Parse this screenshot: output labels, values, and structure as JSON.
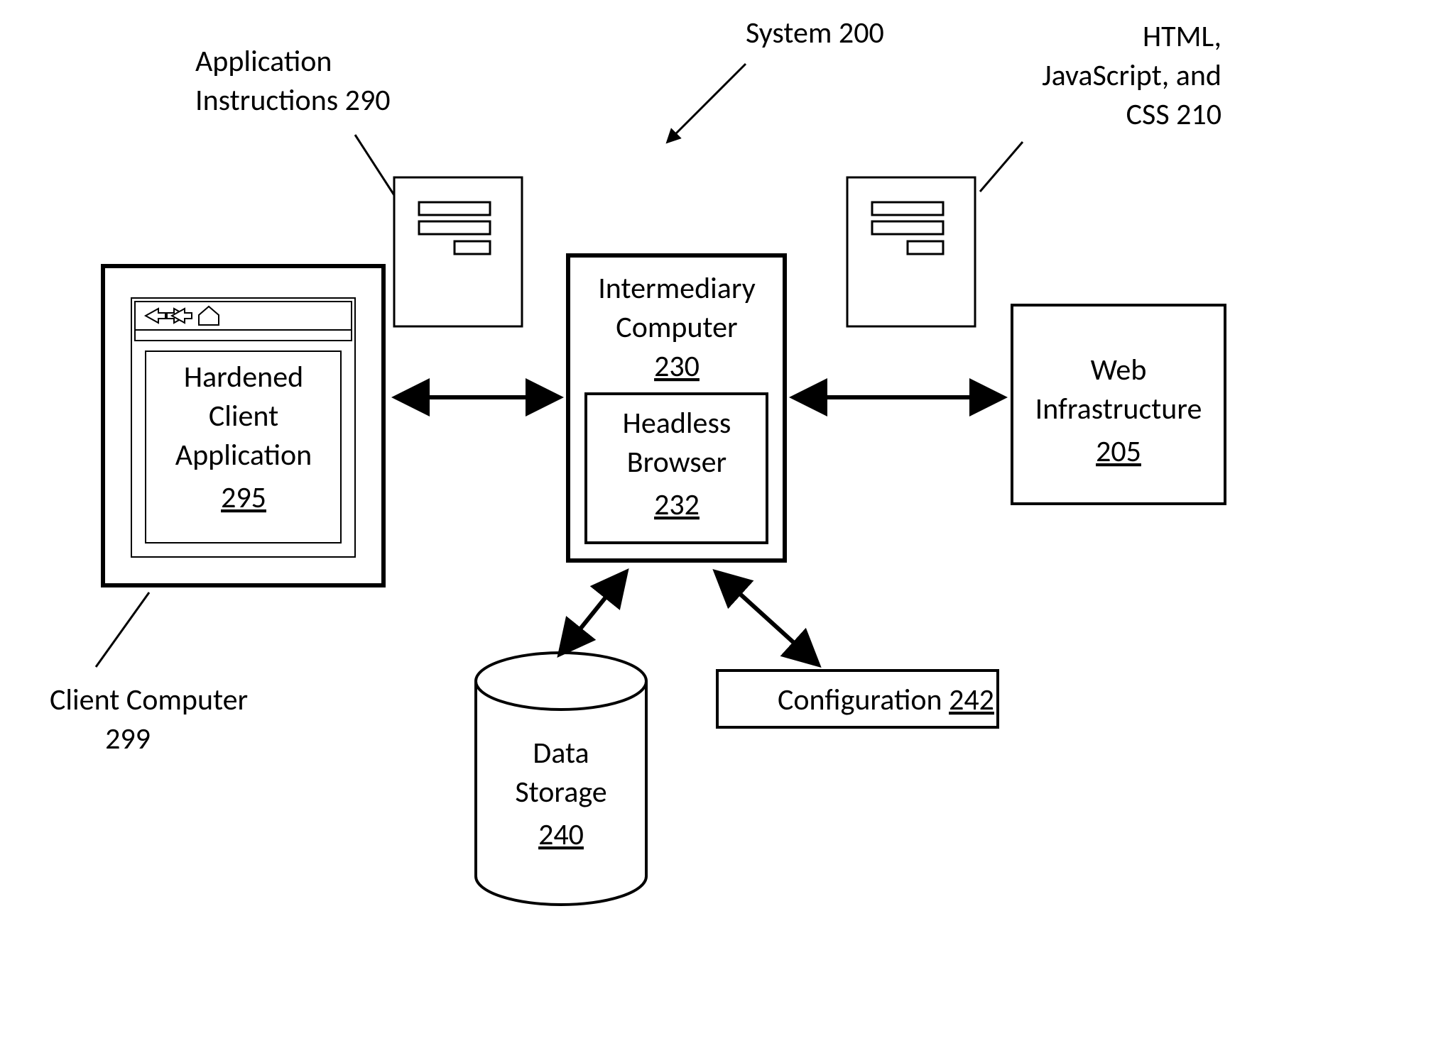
{
  "diagram": {
    "system_label": "System 200",
    "app_instructions": {
      "label_line1": "Application",
      "label_line2": "Instructions 290"
    },
    "html_label": {
      "line1": "HTML,",
      "line2": "JavaScript, and",
      "line3": "CSS 210"
    },
    "client_computer": {
      "label_line1": "Client Computer",
      "label_line2": "299",
      "app_line1": "Hardened",
      "app_line2": "Client",
      "app_line3": "Application",
      "app_ref": "295"
    },
    "intermediary": {
      "line1": "Intermediary",
      "line2": "Computer",
      "ref": "230",
      "headless_line1": "Headless",
      "headless_line2": "Browser",
      "headless_ref": "232"
    },
    "web_infra": {
      "line1": "Web",
      "line2": "Infrastructure",
      "ref": "205"
    },
    "data_storage": {
      "line1": "Data",
      "line2": "Storage",
      "ref": "240"
    },
    "configuration": {
      "label": "Configuration",
      "ref": "242"
    }
  }
}
